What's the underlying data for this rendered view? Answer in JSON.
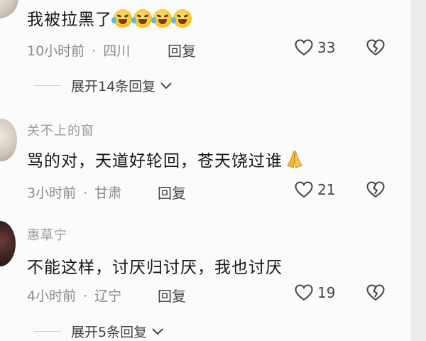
{
  "comment1": {
    "text": "我被拉黑了",
    "emoji": "laughing-crying-emoji",
    "time": "10小时前",
    "region": "四川",
    "reply_label": "回复",
    "likes": "33"
  },
  "expand1": {
    "label": "展开14条回复"
  },
  "comment2": {
    "username": "关不上的窗",
    "text": "骂的对，天道好轮回，苍天饶过谁",
    "emoji": "praying-hands-emoji",
    "time": "3小时前",
    "region": "甘肃",
    "reply_label": "回复",
    "likes": "21"
  },
  "comment3": {
    "username": "惠草宁",
    "text": "不能这样，讨厌归讨厌，我也讨厌",
    "time": "4小时前",
    "region": "辽宁",
    "reply_label": "回复",
    "likes": "19"
  },
  "expand2": {
    "label": "展开5条回复"
  },
  "separator": "·",
  "icons": [
    "heart-icon",
    "dislike-icon",
    "chevron-down-icon"
  ]
}
